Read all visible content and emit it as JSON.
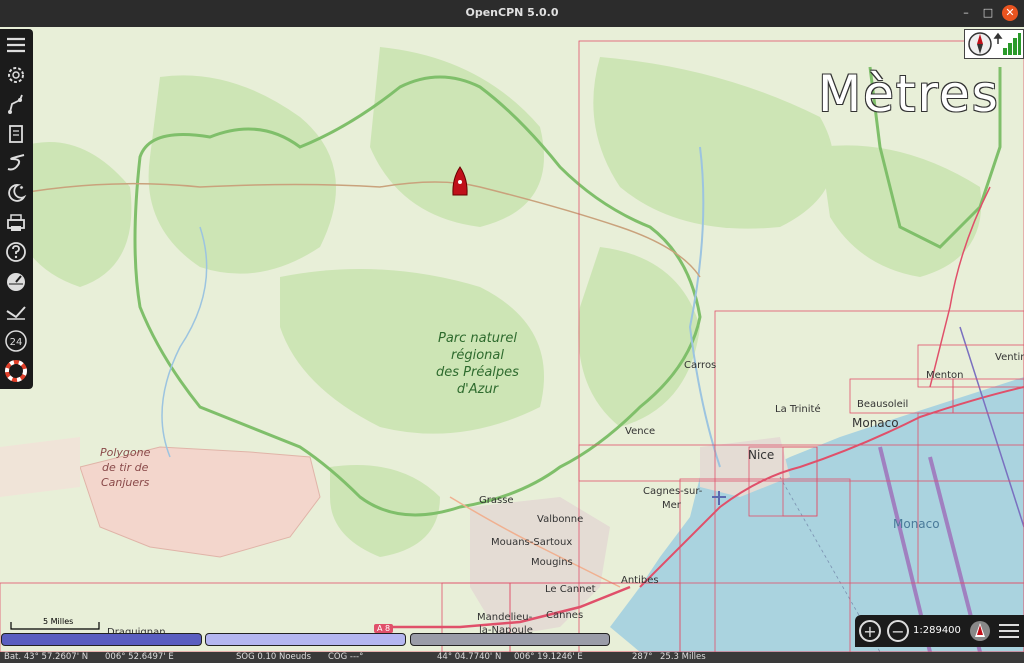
{
  "window": {
    "title": "OpenCPN 5.0.0",
    "minimize": "–",
    "maximize": "□",
    "close": "✕"
  },
  "map_labels": {
    "park": [
      "Parc naturel",
      "régional",
      "des Préalpes",
      "d'Azur"
    ],
    "polygon": [
      "Polygone",
      "de tir de",
      "Canjuers"
    ],
    "places": [
      {
        "name": "Carros"
      },
      {
        "name": "La Trinité"
      },
      {
        "name": "Beausoleil"
      },
      {
        "name": "Menton"
      },
      {
        "name": "Ventim"
      },
      {
        "name": "Monaco"
      },
      {
        "name": "Nice"
      },
      {
        "name": "Vence"
      },
      {
        "name": "Cagnes-sur-"
      },
      {
        "name": "Mer"
      },
      {
        "name": "Grasse"
      },
      {
        "name": "Valbonne"
      },
      {
        "name": "Mouans-Sartoux"
      },
      {
        "name": "Mougins"
      },
      {
        "name": "Antibes"
      },
      {
        "name": "Le Cannet"
      },
      {
        "name": "Cannes"
      },
      {
        "name": "Mandelieu-"
      },
      {
        "name": "la-Napoule"
      },
      {
        "name": "Draguignan"
      },
      {
        "name": "A 8"
      }
    ],
    "monaco_sea": "Monaco"
  },
  "overlay": {
    "units": "Mètres"
  },
  "toolbar": {
    "items": [
      "menu-icon",
      "settings-icon",
      "route-icon",
      "chart-icon",
      "track-icon",
      "tides-icon",
      "print-icon",
      "help-icon",
      "dashboard-icon",
      "ais-icon",
      "tides-24-icon",
      "mob-icon"
    ],
    "label_24": "24"
  },
  "scale_bar": {
    "label": "5 Milles"
  },
  "zoom": {
    "in": "+",
    "out": "−",
    "scale": "1:289400"
  },
  "status": {
    "boat_lat": "Bat. 43° 57.2607' N",
    "boat_lon": "006° 52.6497' E",
    "sog": "SOG 0.10 Noeuds",
    "cog": "COG ---°",
    "cursor_lat": "44° 04.7740' N",
    "cursor_lon": "006° 19.1246' E",
    "bearing": "287°",
    "distance": "25.3 Milles"
  },
  "colors": {
    "sea": "#aad3df",
    "land": "#e8efd8",
    "forest": "#cde5b5",
    "chart_border": "#e0506a",
    "boat": "#c0101a",
    "park_boundary": "#7fbf6a"
  }
}
